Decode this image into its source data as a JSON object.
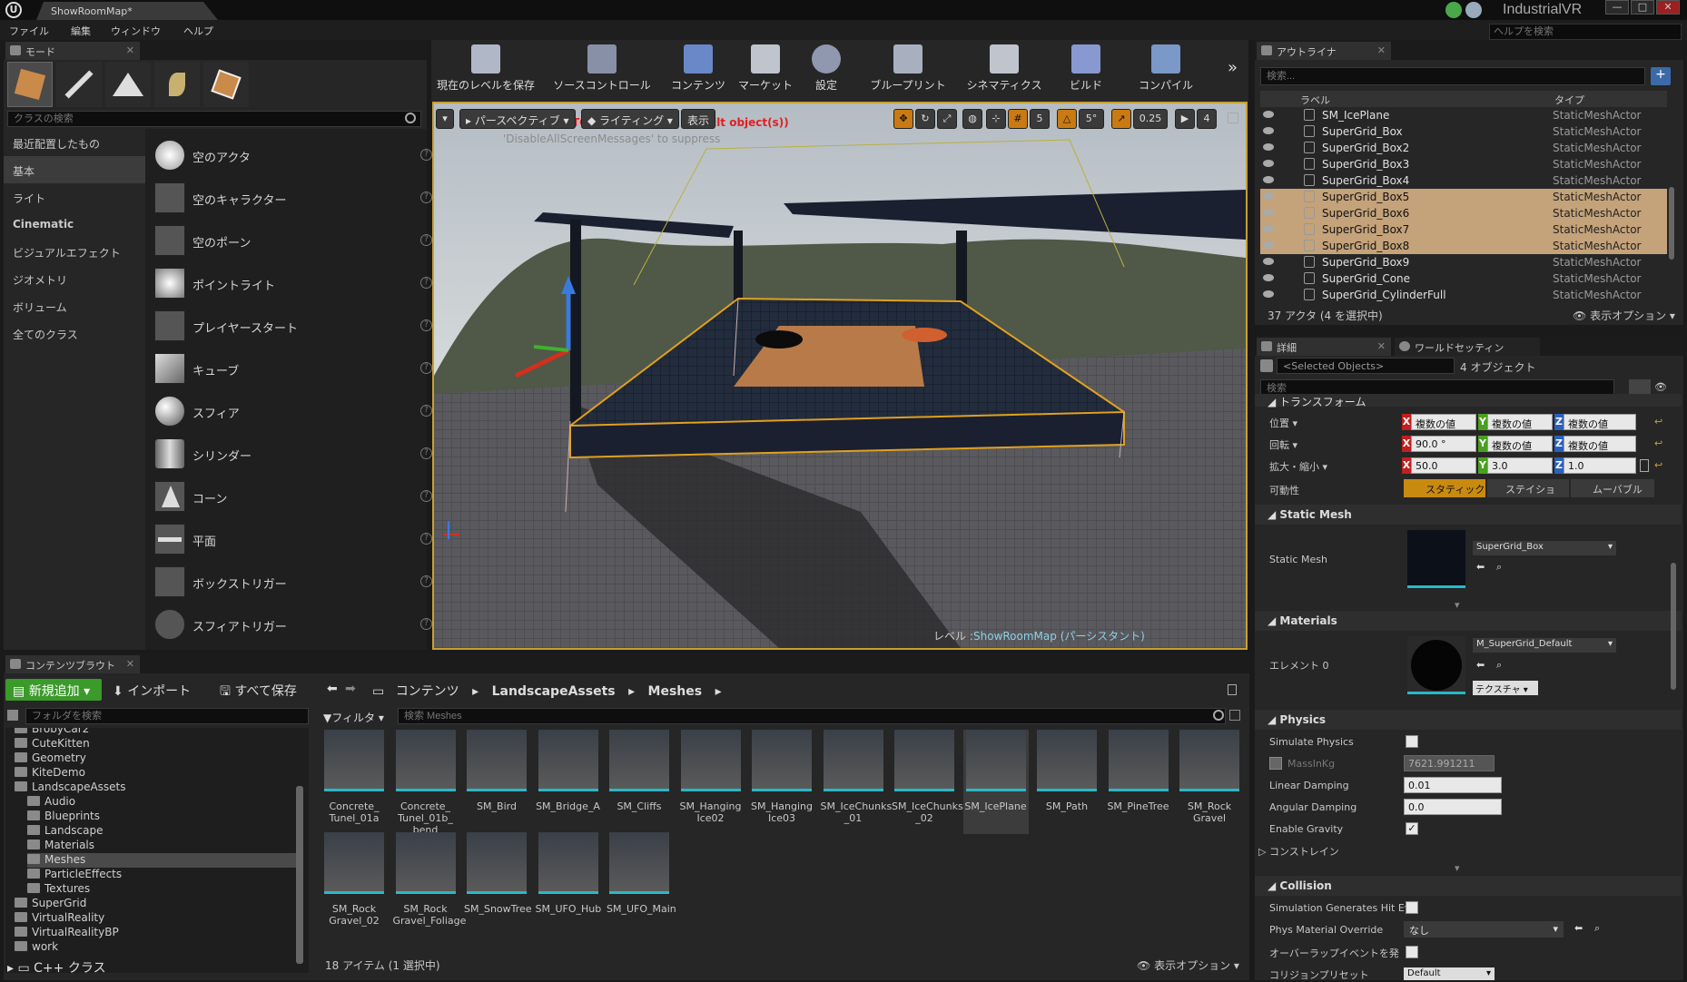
{
  "window": {
    "doc_tab": "ShowRoomMap*",
    "project": "IndustrialVR",
    "minimize": "—",
    "maximize": "□",
    "close": "✕"
  },
  "menu": [
    "ファイル",
    "編集",
    "ウィンドウ",
    "ヘルプ"
  ],
  "help_search_placeholder": "ヘルプを検索",
  "modes": {
    "tab": "モード",
    "search_placeholder": "クラスの検索",
    "categories": [
      "最近配置したもの",
      "基本",
      "ライト",
      "Cinematic",
      "ビジュアルエフェクト",
      "ジオメトリ",
      "ボリューム",
      "全てのクラス"
    ],
    "items": [
      "空のアクタ",
      "空のキャラクター",
      "空のポーン",
      "ポイントライト",
      "プレイヤースタート",
      "キューブ",
      "スフィア",
      "シリンダー",
      "コーン",
      "平面",
      "ボックストリガー",
      "スフィアトリガー"
    ]
  },
  "toolbar": [
    "現在のレベルを保存",
    "ソースコントロール",
    "コンテンツ",
    "マーケット",
    "設定",
    "ブループリント",
    "シネマティクス",
    "ビルド",
    "コンパイル"
  ],
  "viewport": {
    "perspective": "パースペクティブ",
    "lighting": "ライティング",
    "show": "表示",
    "warning": "LIGHTING NEEDS TO BE REBUILT (1 unbuilt object(s))",
    "suppress": "'DisableAllScreenMessages' to suppress",
    "grid": "5",
    "rot": "5°",
    "scale": "0.25",
    "speed": "4",
    "level_label": "レベル :",
    "level_name": "ShowRoomMap (パーシスタント)"
  },
  "outliner": {
    "tab": "アウトライナ",
    "search_placeholder": "検索...",
    "col_label": "ラベル",
    "col_type": "タイプ",
    "rows": [
      {
        "name": "SM_IcePlane",
        "type": "StaticMeshActor",
        "sel": false
      },
      {
        "name": "SuperGrid_Box",
        "type": "StaticMeshActor",
        "sel": false
      },
      {
        "name": "SuperGrid_Box2",
        "type": "StaticMeshActor",
        "sel": false
      },
      {
        "name": "SuperGrid_Box3",
        "type": "StaticMeshActor",
        "sel": false
      },
      {
        "name": "SuperGrid_Box4",
        "type": "StaticMeshActor",
        "sel": false
      },
      {
        "name": "SuperGrid_Box5",
        "type": "StaticMeshActor",
        "sel": true
      },
      {
        "name": "SuperGrid_Box6",
        "type": "StaticMeshActor",
        "sel": true
      },
      {
        "name": "SuperGrid_Box7",
        "type": "StaticMeshActor",
        "sel": true
      },
      {
        "name": "SuperGrid_Box8",
        "type": "StaticMeshActor",
        "sel": true
      },
      {
        "name": "SuperGrid_Box9",
        "type": "StaticMeshActor",
        "sel": false
      },
      {
        "name": "SuperGrid_Cone",
        "type": "StaticMeshActor",
        "sel": false
      },
      {
        "name": "SuperGrid_CylinderFull",
        "type": "StaticMeshActor",
        "sel": false
      }
    ],
    "footer": "37 アクタ (4 を選択中)",
    "view_options": "表示オプション"
  },
  "details": {
    "tab": "詳細",
    "tab2": "ワールドセッティン",
    "selected_field": "<Selected Objects>",
    "count": "4 オブジェクト",
    "search_placeholder": "検索",
    "transform_title": "トランスフォーム",
    "location": {
      "label": "位置",
      "x": "複数の値",
      "y": "複数の値",
      "z": "複数の値"
    },
    "rotation": {
      "label": "回転",
      "x": "90.0 °",
      "y": "複数の値",
      "z": "複数の値"
    },
    "scale": {
      "label": "拡大・縮小",
      "x": "50.0",
      "y": "3.0",
      "z": "1.0"
    },
    "mobility": {
      "label": "可動性",
      "static": "スタティック",
      "stationary": "ステイショ",
      "movable": "ムーバブル"
    },
    "static_mesh_title": "Static Mesh",
    "static_mesh_label": "Static Mesh",
    "static_mesh_value": "SuperGrid_Box",
    "materials_title": "Materials",
    "element_label": "エレメント 0",
    "material_value": "M_SuperGrid_Default",
    "textures_btn": "テクスチャ",
    "physics_title": "Physics",
    "simulate": "Simulate Physics",
    "mass": "MassInKg",
    "mass_value": "7621.991211",
    "linear_damping": "Linear Damping",
    "linear_value": "0.01",
    "angular_damping": "Angular Damping",
    "angular_value": "0.0",
    "gravity": "Enable Gravity",
    "constraints": "コンストレイン",
    "collision_title": "Collision",
    "sim_hit": "Simulation Generates Hit Ev",
    "phys_mat": "Phys Material Override",
    "phys_mat_value": "なし",
    "overlap": "オーバーラップイベントを発",
    "collision_preset": "コリジョンプリセット",
    "preset_value": "Default"
  },
  "content": {
    "tab": "コンテンツブラウト",
    "add_new": "新規追加",
    "import": "インポート",
    "save_all": "すべて保存",
    "breadcrumb": [
      "コンテンツ",
      "LandscapeAssets",
      "Meshes"
    ],
    "folder_search_placeholder": "フォルダを検索",
    "filter": "フィルタ",
    "asset_search_placeholder": "検索 Meshes",
    "tree": [
      {
        "name": "BrobyCar2",
        "d": 0
      },
      {
        "name": "CuteKitten",
        "d": 0
      },
      {
        "name": "Geometry",
        "d": 0
      },
      {
        "name": "KiteDemo",
        "d": 0
      },
      {
        "name": "LandscapeAssets",
        "d": 0
      },
      {
        "name": "Audio",
        "d": 1
      },
      {
        "name": "Blueprints",
        "d": 1
      },
      {
        "name": "Landscape",
        "d": 1
      },
      {
        "name": "Materials",
        "d": 1
      },
      {
        "name": "Meshes",
        "d": 1
      },
      {
        "name": "ParticleEffects",
        "d": 1
      },
      {
        "name": "Textures",
        "d": 1
      },
      {
        "name": "SuperGrid",
        "d": 0
      },
      {
        "name": "VirtualReality",
        "d": 0
      },
      {
        "name": "VirtualRealityBP",
        "d": 0
      },
      {
        "name": "work",
        "d": 0
      }
    ],
    "cpp": "C++ クラス",
    "assets": [
      "Concrete_ Tunel_01a",
      "Concrete_ Tunel_01b_ bend",
      "SM_Bird",
      "SM_Bridge_A",
      "SM_Cliffs",
      "SM_Hanging Ice02",
      "SM_Hanging Ice03",
      "SM_IceChunks _01",
      "SM_IceChunks _02",
      "SM_IcePlane",
      "SM_Path",
      "SM_PineTree",
      "SM_Rock Gravel",
      "SM_Rock Gravel_02",
      "SM_Rock Gravel_Foliage",
      "SM_SnowTree",
      "SM_UFO_Hub",
      "SM_UFO_Main"
    ],
    "footer": "18 アイテム (1 選択中)",
    "view_options": "表示オプション"
  }
}
